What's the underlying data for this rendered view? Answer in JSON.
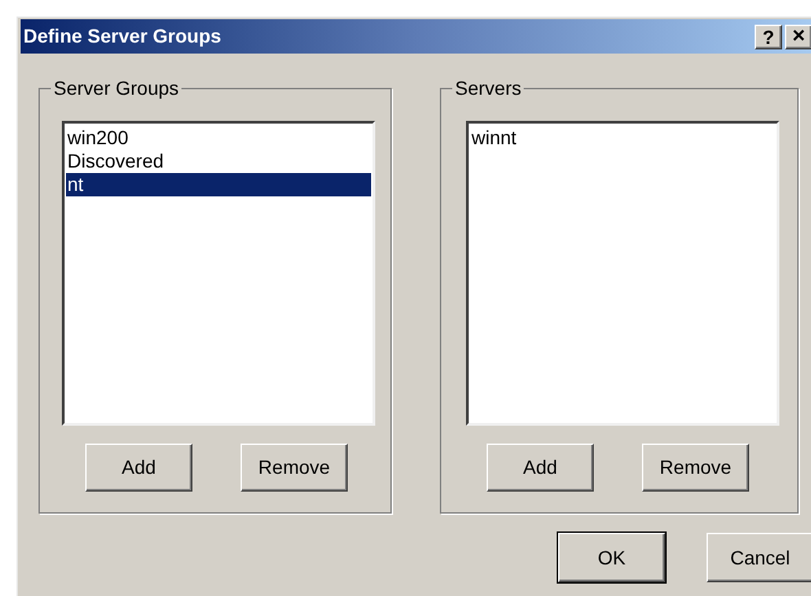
{
  "window": {
    "title": "Define Server Groups",
    "help_button": "?",
    "close_button": "×"
  },
  "groups": [
    {
      "title": "Server Groups",
      "items": [
        {
          "label": "win200",
          "selected": false
        },
        {
          "label": "Discovered",
          "selected": false
        },
        {
          "label": "nt",
          "selected": true
        }
      ],
      "buttons": [
        "Add",
        "Remove"
      ]
    },
    {
      "title": "Servers",
      "items": [
        {
          "label": "winnt",
          "selected": false
        }
      ],
      "buttons": [
        "Add",
        "Remove"
      ]
    }
  ],
  "buttons": [
    {
      "label": "OK",
      "default": true
    },
    {
      "label": "Cancel",
      "default": false
    }
  ]
}
